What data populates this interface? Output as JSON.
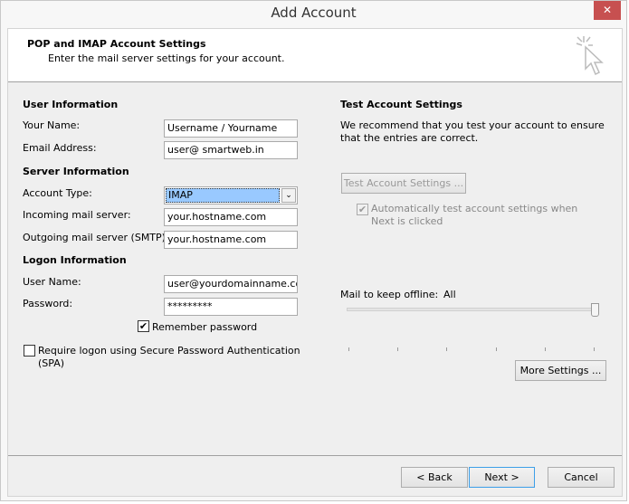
{
  "window": {
    "title": "Add Account",
    "close_icon": "close-icon"
  },
  "header": {
    "title": "POP and IMAP Account Settings",
    "subtitle": "Enter the mail server settings for your account.",
    "icon": "cursor-click-icon"
  },
  "user_info": {
    "heading": "User Information",
    "name_label": "Your Name:",
    "name_value": "Username / Yourname",
    "email_label": "Email Address:",
    "email_value": "user@ smartweb.in"
  },
  "server_info": {
    "heading": "Server Information",
    "account_type_label": "Account Type:",
    "account_type_value": "IMAP",
    "incoming_label": "Incoming mail server:",
    "incoming_value": "your.hostname.com",
    "outgoing_label": "Outgoing mail server (SMTP):",
    "outgoing_value": "your.hostname.com"
  },
  "logon_info": {
    "heading": "Logon Information",
    "username_label": "User Name:",
    "username_value": "user@yourdomainname.com",
    "password_label": "Password:",
    "password_value": "*********",
    "remember_label": "Remember password",
    "remember_checked": true,
    "spa_label": "Require logon using Secure Password Authentication (SPA)",
    "spa_checked": false
  },
  "test": {
    "heading": "Test Account Settings",
    "description": "We recommend that you test your account to ensure that the entries are correct.",
    "test_button": "Test Account Settings ...",
    "auto_test_label": "Automatically test account settings when Next is clicked",
    "auto_test_checked": true
  },
  "offline": {
    "label": "Mail to keep offline:",
    "value": "All",
    "slider_level": 1.0
  },
  "buttons": {
    "more_settings": "More Settings ...",
    "back": "< Back",
    "next": "Next >",
    "cancel": "Cancel"
  }
}
